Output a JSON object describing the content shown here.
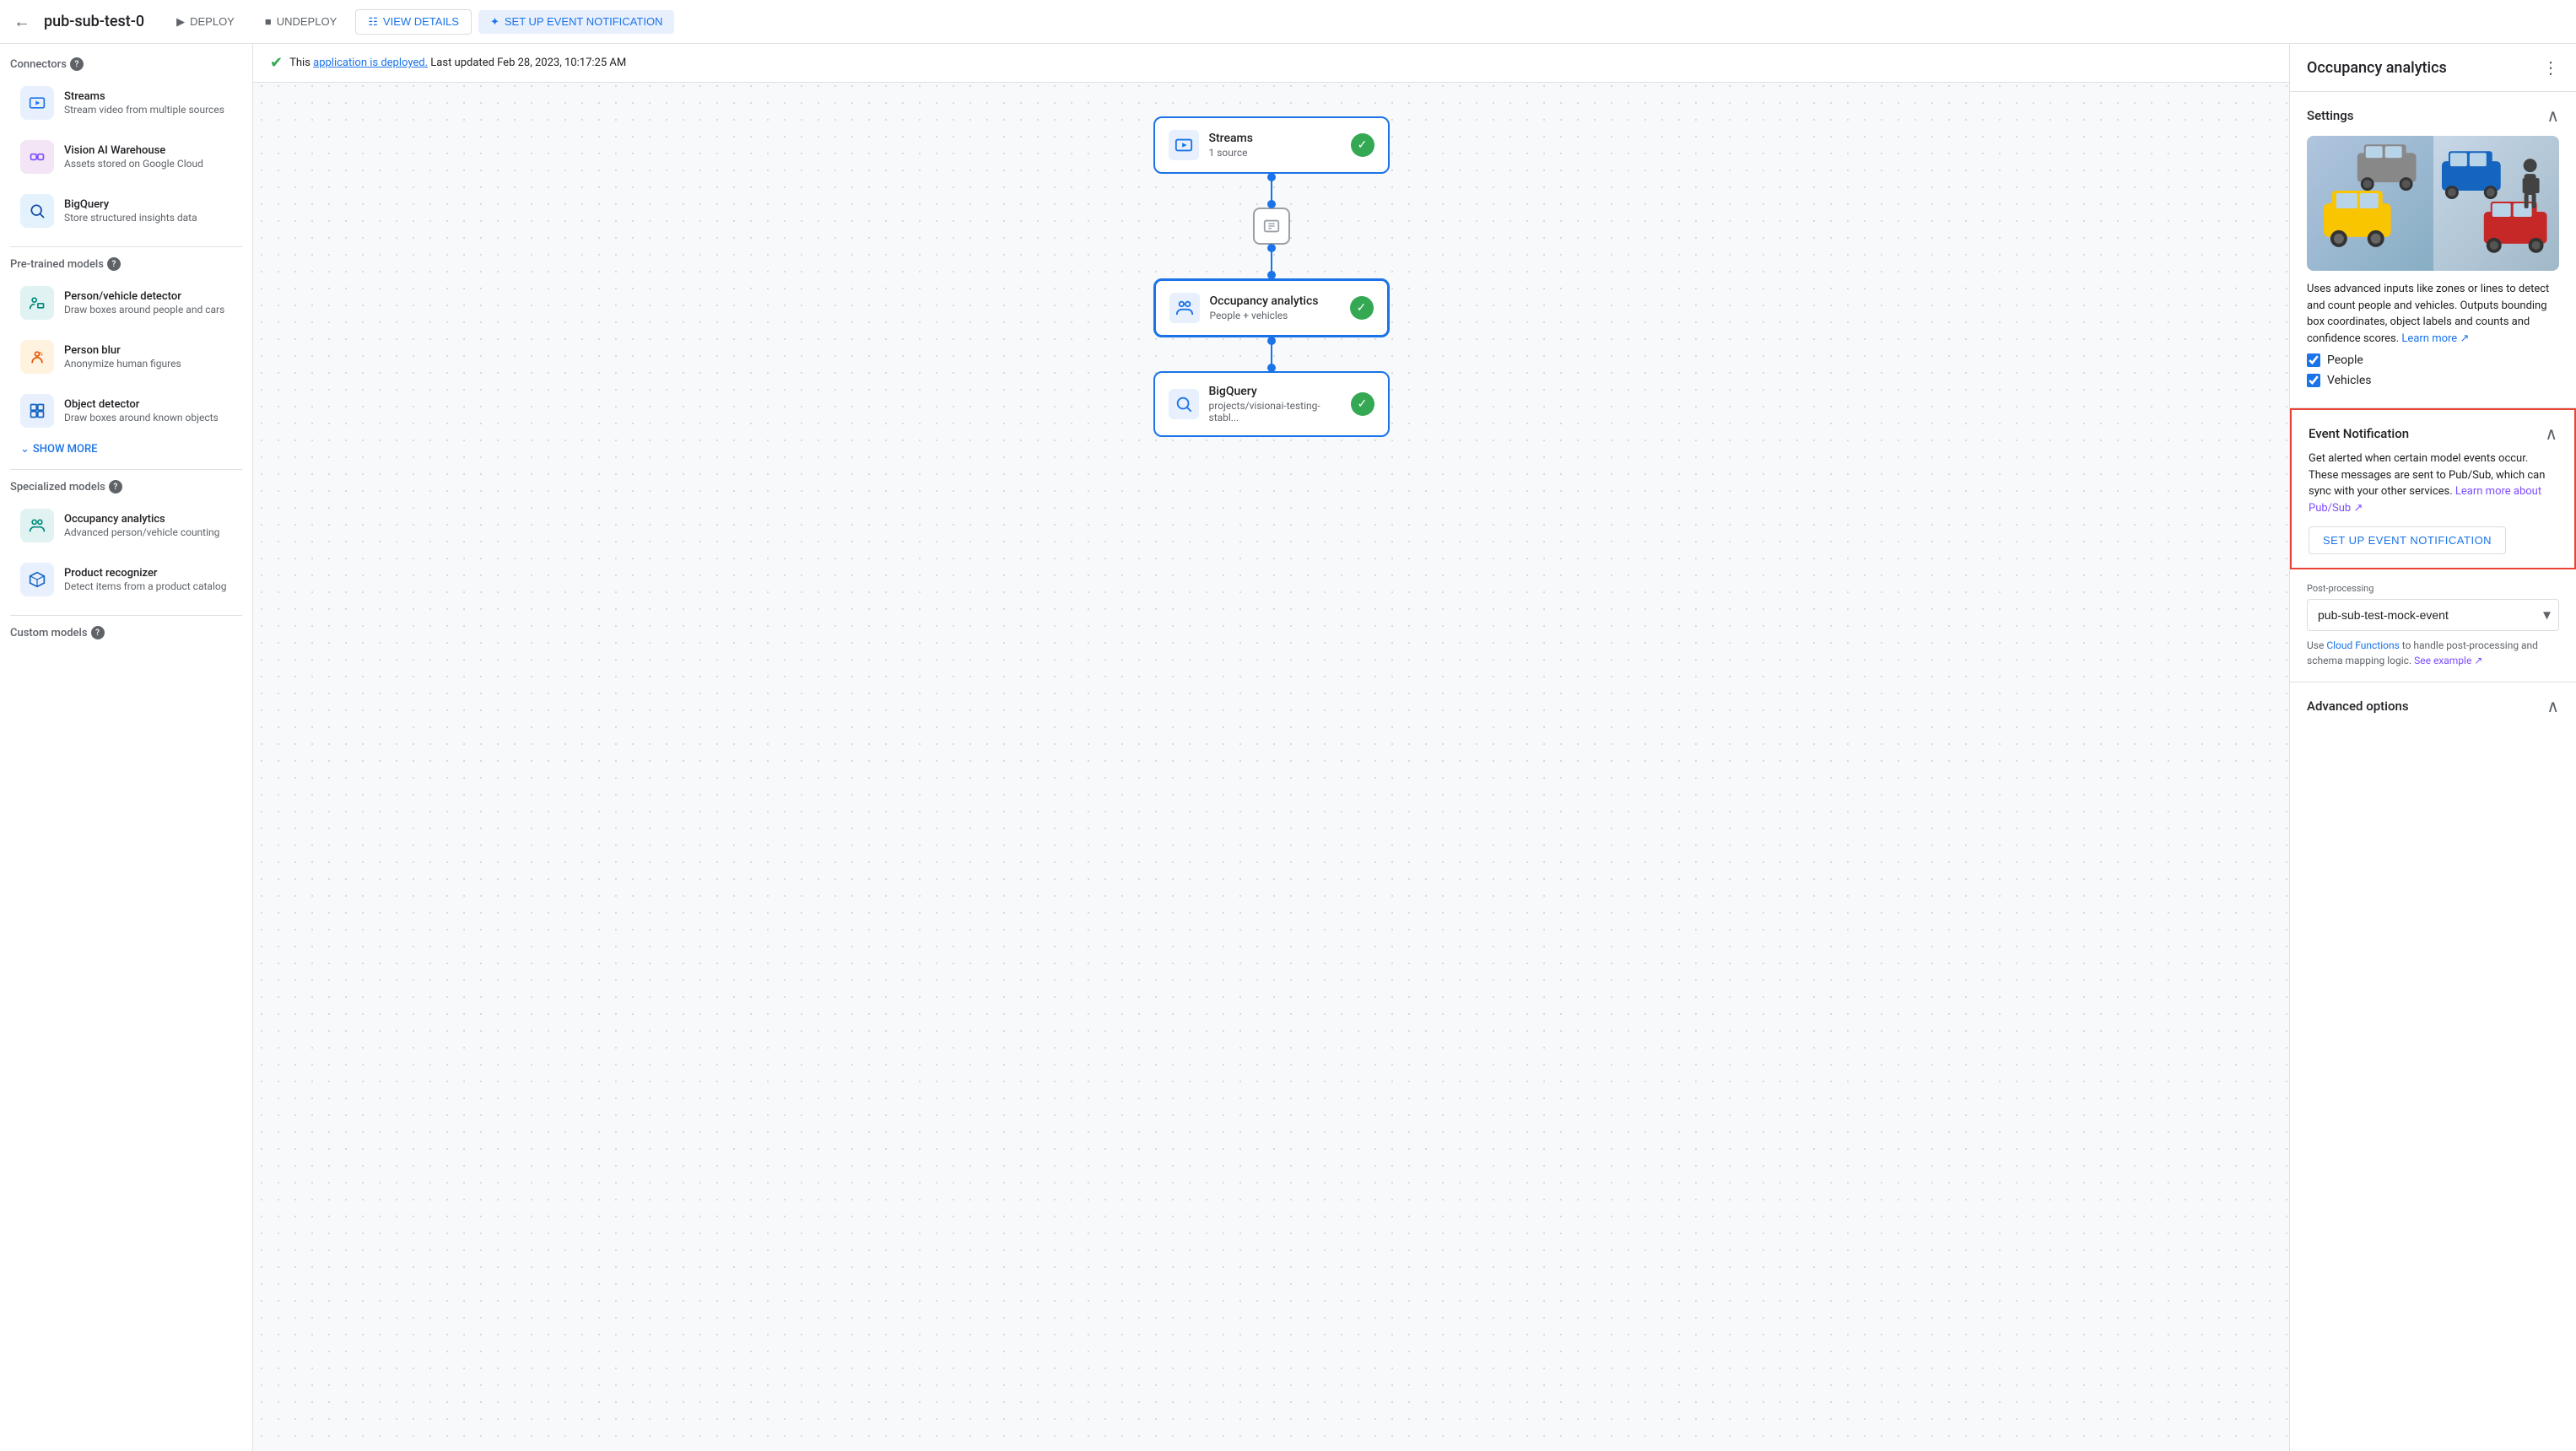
{
  "nav": {
    "back_icon": "←",
    "title": "pub-sub-test-0",
    "deploy_label": "DEPLOY",
    "undeploy_label": "UNDEPLOY",
    "view_details_label": "VIEW DETAILS",
    "setup_event_label": "SET UP EVENT NOTIFICATION"
  },
  "status": {
    "icon": "✓",
    "message": "This",
    "link_text": "application is deployed.",
    "timestamp": "Last updated Feb 28, 2023, 10:17:25 AM"
  },
  "sidebar": {
    "connectors_title": "Connectors",
    "connectors": [
      {
        "id": "streams",
        "icon": "📹",
        "title": "Streams",
        "subtitle": "Stream video from multiple sources"
      },
      {
        "id": "vision-ai",
        "icon": "☁",
        "title": "Vision AI Warehouse",
        "subtitle": "Assets stored on Google Cloud"
      },
      {
        "id": "bigquery",
        "icon": "🔍",
        "title": "BigQuery",
        "subtitle": "Store structured insights data"
      }
    ],
    "pretrained_title": "Pre-trained models",
    "pretrained": [
      {
        "id": "person-vehicle",
        "icon": "👥",
        "title": "Person/vehicle detector",
        "subtitle": "Draw boxes around people and cars"
      },
      {
        "id": "person-blur",
        "icon": "👤",
        "title": "Person blur",
        "subtitle": "Anonymize human figures"
      },
      {
        "id": "object-detector",
        "icon": "📦",
        "title": "Object detector",
        "subtitle": "Draw boxes around known objects"
      }
    ],
    "show_more_label": "SHOW MORE",
    "specialized_title": "Specialized models",
    "specialized": [
      {
        "id": "occupancy",
        "icon": "👥",
        "title": "Occupancy analytics",
        "subtitle": "Advanced person/vehicle counting"
      },
      {
        "id": "product-recognizer",
        "icon": "👕",
        "title": "Product recognizer",
        "subtitle": "Detect items from a product catalog"
      }
    ],
    "custom_title": "Custom models"
  },
  "flow": {
    "nodes": [
      {
        "id": "streams-node",
        "icon": "📹",
        "title": "Streams",
        "subtitle": "1 source",
        "checked": true
      },
      {
        "id": "occupancy-node",
        "icon": "👥",
        "title": "Occupancy analytics",
        "subtitle": "People + vehicles",
        "checked": true,
        "active": true
      },
      {
        "id": "bigquery-node",
        "icon": "📊",
        "title": "BigQuery",
        "subtitle": "projects/visionai-testing-stabl...",
        "checked": true
      }
    ]
  },
  "right_panel": {
    "title": "Occupancy analytics",
    "settings_title": "Settings",
    "description": "Uses advanced inputs like zones or lines to detect and count people and vehicles. Outputs bounding box coordinates, object labels and counts and confidence scores.",
    "learn_more_text": "Learn more",
    "checkboxes": [
      {
        "id": "people",
        "label": "People",
        "checked": true
      },
      {
        "id": "vehicles",
        "label": "Vehicles",
        "checked": true
      }
    ],
    "event_notification": {
      "title": "Event Notification",
      "description": "Get alerted when certain model events occur. These messages are sent to Pub/Sub, which can sync with your other services.",
      "learn_more_text": "Learn more about Pub/Sub",
      "setup_btn_label": "SET UP EVENT NOTIFICATION"
    },
    "post_processing": {
      "label": "Post-processing",
      "value": "pub-sub-test-mock-event",
      "description": "Use Cloud Functions to handle post-processing and schema mapping logic.",
      "see_example_text": "See example"
    },
    "advanced": {
      "title": "Advanced options"
    }
  }
}
